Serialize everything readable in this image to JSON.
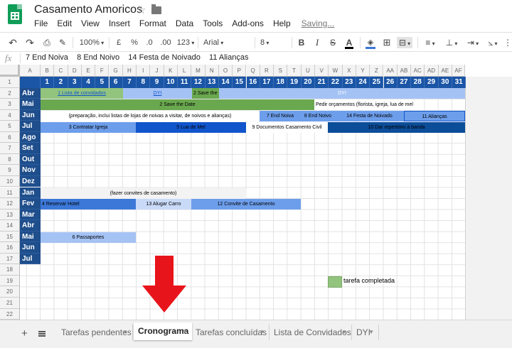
{
  "title_bar": {
    "doc_title": "Casamento Amoricos",
    "saving": "Saving..."
  },
  "menu": [
    "File",
    "Edit",
    "View",
    "Insert",
    "Format",
    "Data",
    "Tools",
    "Add-ons",
    "Help"
  ],
  "toolbar": {
    "zoom": "100%",
    "currency": "£",
    "percent": "%",
    "dec_less": ".0",
    "dec_more": ".00",
    "more_formats": "123",
    "font": "Arial",
    "font_size": "8",
    "bold": "B",
    "italic": "I",
    "strike": "S",
    "text_color": "A"
  },
  "formula_bar": {
    "fx": "fx",
    "content": "7 End Noiva    8 End Noivo    14 Festa de Noivado    11 Alianças"
  },
  "sheet": {
    "columns": [
      "A",
      "B",
      "C",
      "D",
      "E",
      "F",
      "G",
      "H",
      "I",
      "J",
      "K",
      "L",
      "M",
      "N",
      "O",
      "P",
      "Q",
      "R",
      "S",
      "T",
      "U",
      "V",
      "W",
      "X",
      "Y",
      "Z",
      "AA",
      "AB",
      "AC",
      "AD",
      "AE",
      "AF"
    ],
    "rows": [
      "1",
      "2",
      "3",
      "4",
      "5",
      "6",
      "7",
      "8",
      "9",
      "10",
      "11",
      "12",
      "13",
      "14",
      "15",
      "16",
      "17",
      "18",
      "19",
      "20",
      "21",
      "22"
    ],
    "days": [
      "1",
      "2",
      "3",
      "4",
      "5",
      "6",
      "7",
      "8",
      "9",
      "10",
      "11",
      "12",
      "13",
      "14",
      "15",
      "16",
      "17",
      "18",
      "19",
      "20",
      "21",
      "22",
      "23",
      "24",
      "25",
      "26",
      "27",
      "28",
      "29",
      "30",
      "31"
    ],
    "months": [
      "Abr",
      "Mai",
      "Jun",
      "Jul",
      "Ago",
      "Set",
      "Out",
      "Nov",
      "Dez",
      "Jan",
      "Fev",
      "Mar",
      "Abr",
      "Mai",
      "Jun",
      "Jul"
    ],
    "tasks": {
      "lista_convidados": "1 Lista de convidados",
      "dyi_1": "DYI",
      "save_date_short": "2 Save the",
      "dyi_2": "DYI",
      "save_date": "2 Save the Date",
      "pedir_orcamentos": "Pedir orçamentos (florista, igreja, lua de mel",
      "preparacao": "(preparação, inclui listas de lojas de noivas a visitar, de noivos e alianças)",
      "end_noiva": "7 End Noiva",
      "end_noivo": "8 End Noivo",
      "festa_noivado": "14 Festa de Noivado",
      "aliancas": "11 Alianças",
      "contratar_igreja": "3 Contratar Igreja",
      "lua_de_mel": "5 Lua de Mel",
      "documentos": "9 Documentos Casamento Civil",
      "reportorio": "10 Dar repertório à banda",
      "convites": "(fazer convites de casamento)",
      "reservar_hotel": "4 Reservar Hotel",
      "alugar_carro": "13 Alugar Carro",
      "convite_casamento": "12 Convite de Casamento",
      "passaportes": "6 Passaportes"
    },
    "legend_label": "tarefa completada"
  },
  "sheet_tabs": [
    "Tarefas pendentes",
    "Cronograma",
    "Tarefas concluídas",
    "Lista de Convidados",
    "DYI"
  ],
  "active_tab": "Cronograma",
  "colors": {
    "header_blue": "#1a55a6",
    "month_blue": "#1f4e8c",
    "completed_green": "#93c47d",
    "save_date_green": "#6aa84f",
    "light_blue": "#a4c2f4",
    "mid_blue": "#6d9eeb",
    "royal_blue": "#1155cc",
    "navy": "#0b4d99",
    "arrow_red": "#e8141b"
  }
}
